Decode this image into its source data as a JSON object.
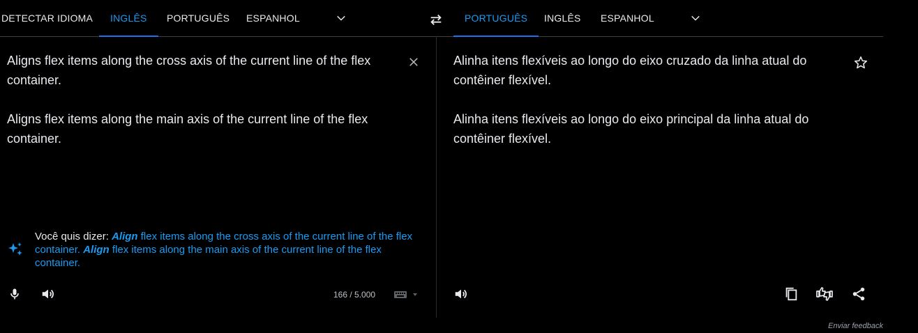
{
  "source_languages": {
    "tabs": [
      {
        "label": "DETECTAR IDIOMA",
        "active": false
      },
      {
        "label": "INGLÊS",
        "active": true
      },
      {
        "label": "PORTUGUÊS",
        "active": false
      },
      {
        "label": "ESPANHOL",
        "active": false
      }
    ]
  },
  "target_languages": {
    "tabs": [
      {
        "label": "PORTUGUÊS",
        "active": true
      },
      {
        "label": "INGLÊS",
        "active": false
      },
      {
        "label": "ESPANHOL",
        "active": false
      }
    ]
  },
  "source": {
    "text": "Aligns flex items along the cross axis of the current line of the flex container.\n\nAligns flex items along the main axis of the current line of the flex container.",
    "char_count": "166 / 5.000"
  },
  "suggestion": {
    "prefix": "Você quis dizer: ",
    "part1_bold": "Align",
    "part1_rest": " flex items along the cross axis of the current line of the flex container. ",
    "part2_bold": "Align",
    "part2_rest": " flex items along the main axis of the current line of the flex container."
  },
  "target": {
    "text": "Alinha itens flexíveis ao longo do eixo cruzado da linha atual do contêiner flexível.\n\nAlinha itens flexíveis ao longo do eixo principal da linha atual do contêiner flexível."
  },
  "footer": {
    "feedback_label": "Enviar feedback"
  },
  "colors": {
    "accent": "#1a9bf2",
    "background": "#000000",
    "text": "#e8eaed"
  }
}
